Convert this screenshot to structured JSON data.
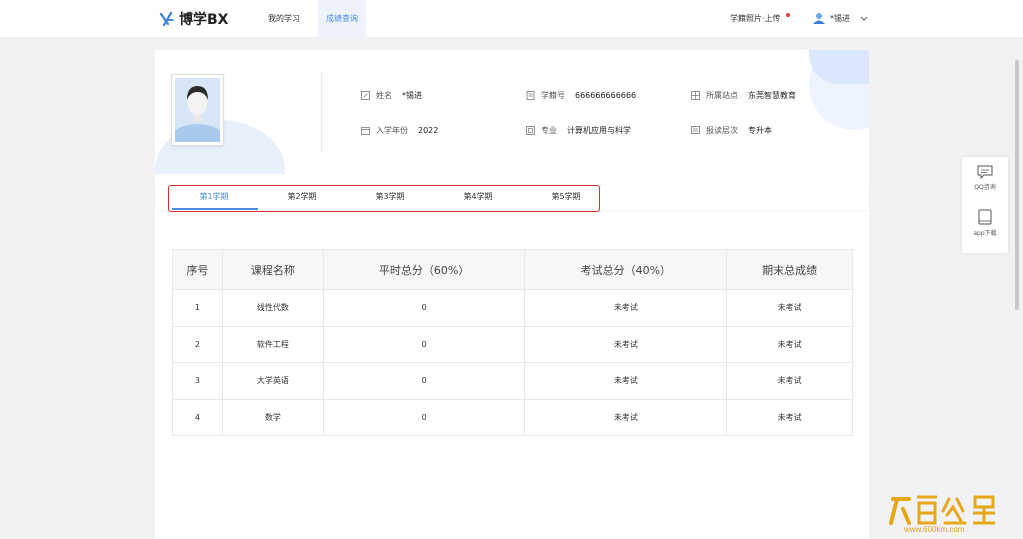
{
  "header": {
    "logo_text": "博学BX",
    "nav": [
      {
        "label": "我的学习"
      },
      {
        "label": "成绩查询"
      }
    ],
    "upload_label": "学籍照片·上传",
    "user_name": "*锡进"
  },
  "profile": {
    "name_label": "姓名",
    "name_value": "*锡进",
    "student_id_label": "学籍号",
    "student_id_value": "666666666666",
    "site_label": "所属站点",
    "site_value": "东莞智慧教育",
    "year_label": "入学年份",
    "year_value": "2022",
    "major_label": "专业",
    "major_value": "计算机应用与科学",
    "level_label": "报读层次",
    "level_value": "专升本"
  },
  "tabs": [
    {
      "label": "第1学期"
    },
    {
      "label": "第2学期"
    },
    {
      "label": "第3学期"
    },
    {
      "label": "第4学期"
    },
    {
      "label": "第5学期"
    }
  ],
  "table": {
    "headers": [
      "序号",
      "课程名称",
      "平时总分（60%）",
      "考试总分（40%）",
      "期末总成绩"
    ],
    "rows": [
      [
        "1",
        "线性代数",
        "0",
        "未考试",
        "未考试"
      ],
      [
        "2",
        "软件工程",
        "0",
        "未考试",
        "未考试"
      ],
      [
        "3",
        "大学英语",
        "0",
        "未考试",
        "未考试"
      ],
      [
        "4",
        "数学",
        "0",
        "未考试",
        "未考试"
      ]
    ]
  },
  "float": {
    "qq_label": "QQ咨询",
    "app_label": "app下载"
  },
  "watermark": {
    "text": "www.600km.com"
  },
  "colors": {
    "accent": "#4a8de0",
    "highlight_box": "#d8312f"
  }
}
